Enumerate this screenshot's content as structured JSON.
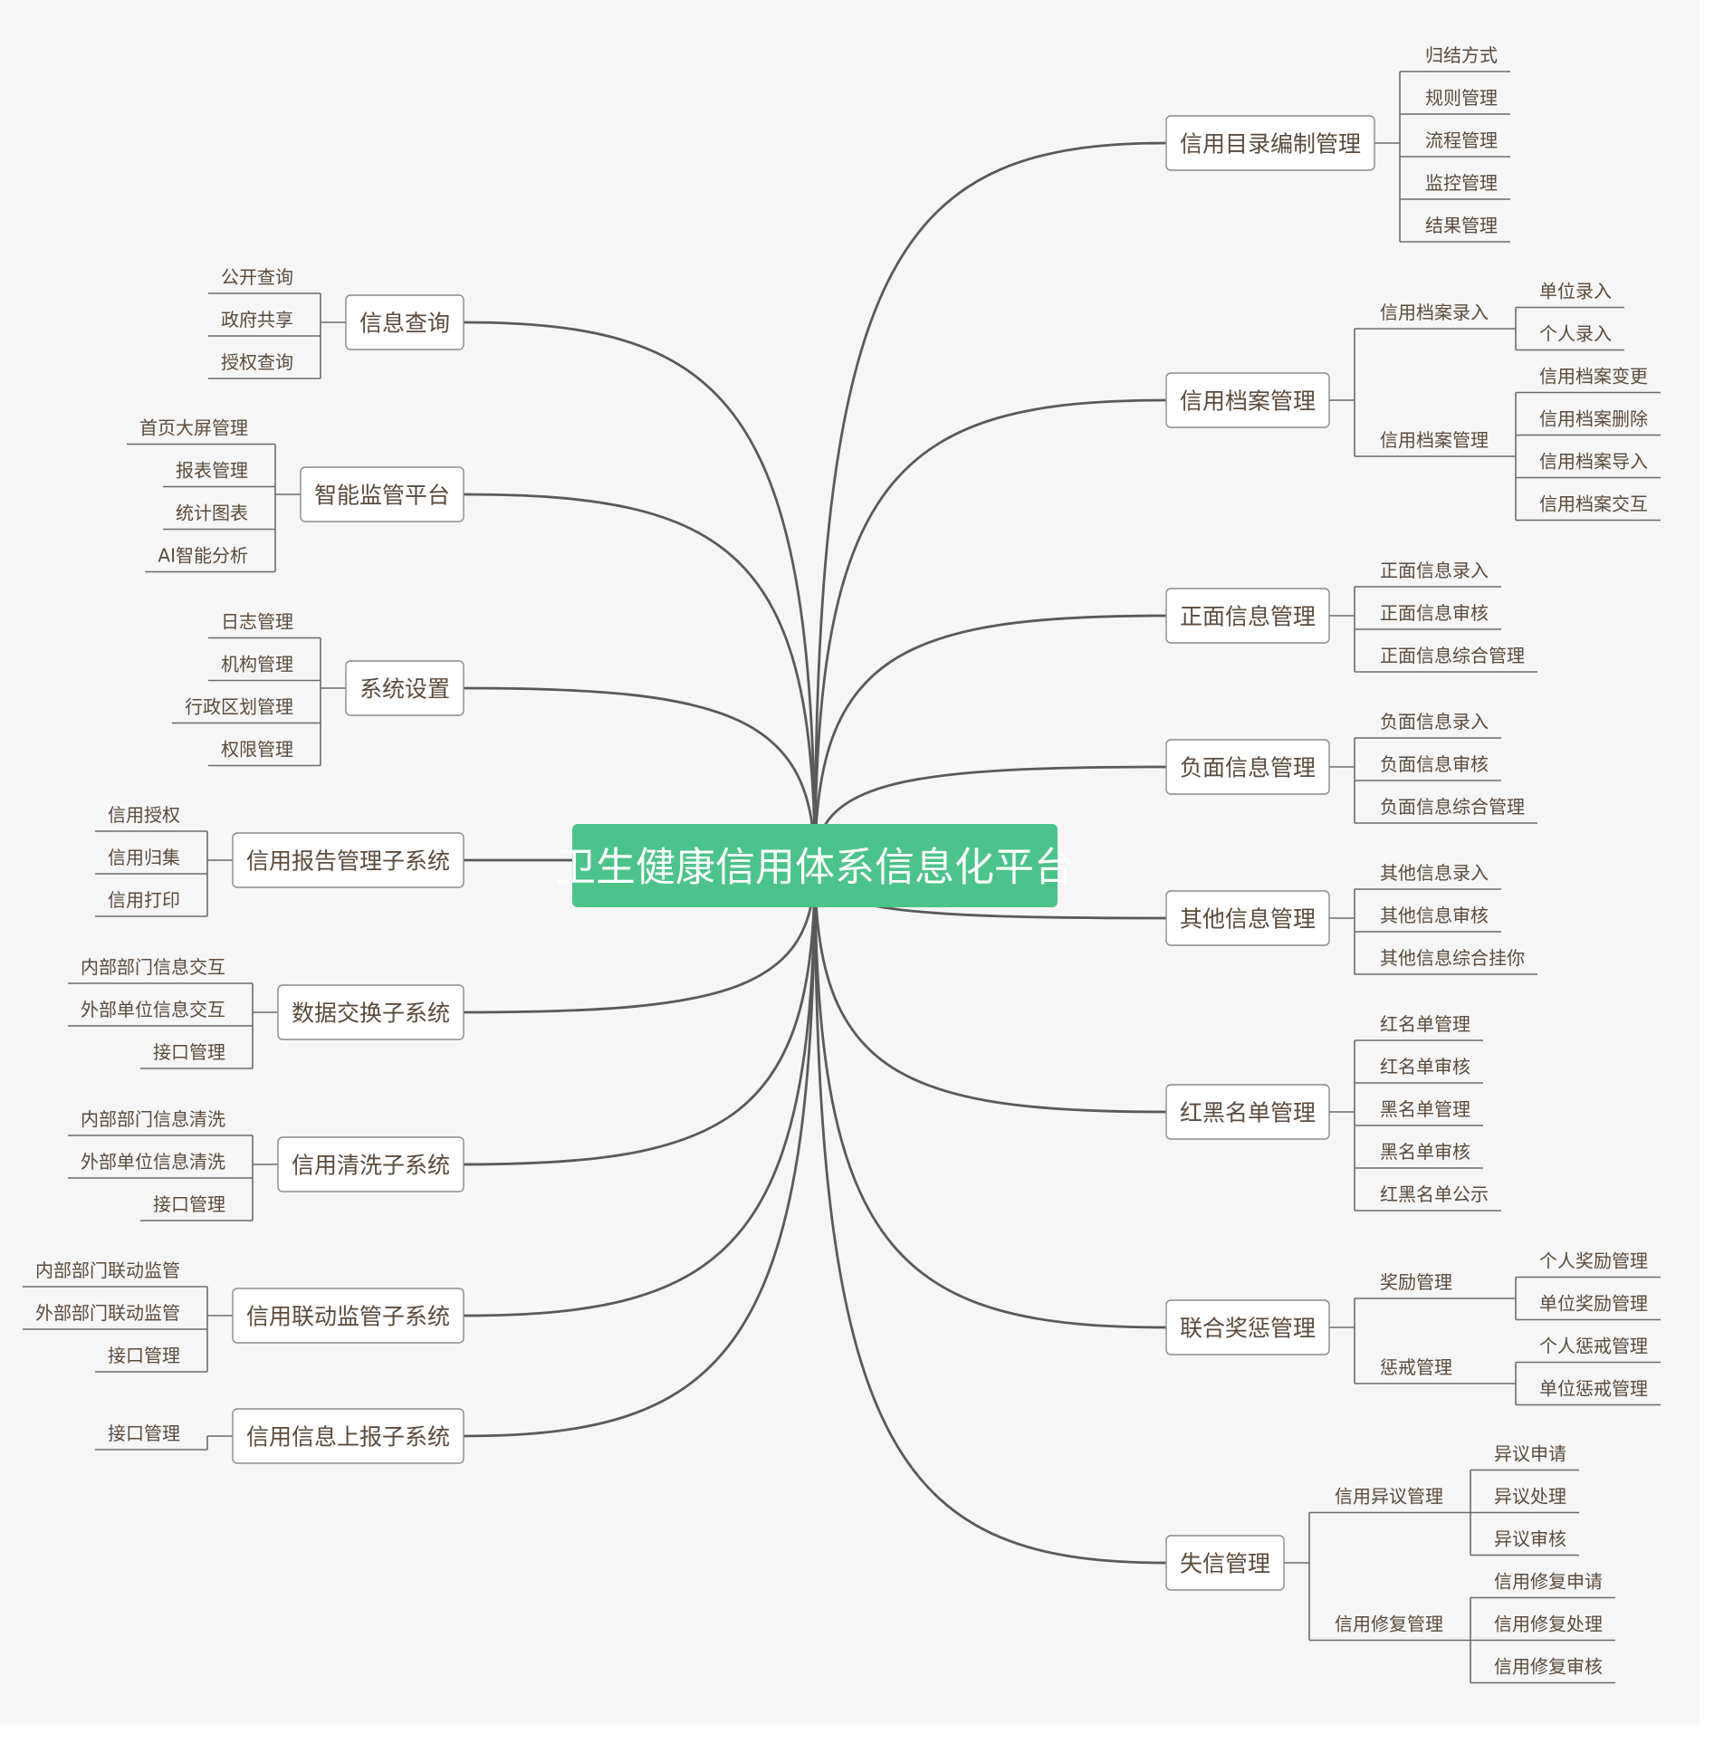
{
  "root": "卫生健康信用体系信息化平台",
  "colors": {
    "background": "#f6f6f6",
    "root_fill": "#4cc38a",
    "root_text": "#ffffff",
    "line": "#5a5a5a",
    "node_border": "#8a8a8a",
    "node_text": "#5b4a3a"
  },
  "left_branches": [
    {
      "label": "信息查询",
      "children": [
        {
          "label": "公开查询"
        },
        {
          "label": "政府共享"
        },
        {
          "label": "授权查询"
        }
      ]
    },
    {
      "label": "智能监管平台",
      "children": [
        {
          "label": "首页大屏管理"
        },
        {
          "label": "报表管理"
        },
        {
          "label": "统计图表"
        },
        {
          "label": "AI智能分析"
        }
      ]
    },
    {
      "label": "系统设置",
      "children": [
        {
          "label": "日志管理"
        },
        {
          "label": "机构管理"
        },
        {
          "label": "行政区划管理"
        },
        {
          "label": "权限管理"
        }
      ]
    },
    {
      "label": "信用报告管理子系统",
      "children": [
        {
          "label": "信用授权"
        },
        {
          "label": "信用归集"
        },
        {
          "label": "信用打印"
        }
      ]
    },
    {
      "label": "数据交换子系统",
      "children": [
        {
          "label": "内部部门信息交互"
        },
        {
          "label": "外部单位信息交互"
        },
        {
          "label": "接口管理"
        }
      ]
    },
    {
      "label": "信用清洗子系统",
      "children": [
        {
          "label": "内部部门信息清洗"
        },
        {
          "label": "外部单位信息清洗"
        },
        {
          "label": "接口管理"
        }
      ]
    },
    {
      "label": "信用联动监管子系统",
      "children": [
        {
          "label": "内部部门联动监管"
        },
        {
          "label": "外部部门联动监管"
        },
        {
          "label": "接口管理"
        }
      ]
    },
    {
      "label": "信用信息上报子系统",
      "children": [
        {
          "label": "接口管理"
        }
      ]
    }
  ],
  "right_branches": [
    {
      "label": "信用目录编制管理",
      "children": [
        {
          "label": "归结方式"
        },
        {
          "label": "规则管理"
        },
        {
          "label": "流程管理"
        },
        {
          "label": "监控管理"
        },
        {
          "label": "结果管理"
        }
      ]
    },
    {
      "label": "信用档案管理",
      "children": [
        {
          "label": "信用档案录入",
          "children": [
            {
              "label": "单位录入"
            },
            {
              "label": "个人录入"
            }
          ]
        },
        {
          "label": "信用档案管理",
          "children": [
            {
              "label": "信用档案变更"
            },
            {
              "label": "信用档案删除"
            },
            {
              "label": "信用档案导入"
            },
            {
              "label": "信用档案交互"
            }
          ]
        }
      ]
    },
    {
      "label": "正面信息管理",
      "children": [
        {
          "label": "正面信息录入"
        },
        {
          "label": "正面信息审核"
        },
        {
          "label": "正面信息综合管理"
        }
      ]
    },
    {
      "label": "负面信息管理",
      "children": [
        {
          "label": "负面信息录入"
        },
        {
          "label": "负面信息审核"
        },
        {
          "label": "负面信息综合管理"
        }
      ]
    },
    {
      "label": "其他信息管理",
      "children": [
        {
          "label": "其他信息录入"
        },
        {
          "label": "其他信息审核"
        },
        {
          "label": "其他信息综合挂你"
        }
      ]
    },
    {
      "label": "红黑名单管理",
      "children": [
        {
          "label": "红名单管理"
        },
        {
          "label": "红名单审核"
        },
        {
          "label": "黑名单管理"
        },
        {
          "label": "黑名单审核"
        },
        {
          "label": "红黑名单公示"
        }
      ]
    },
    {
      "label": "联合奖惩管理",
      "children": [
        {
          "label": "奖励管理",
          "children": [
            {
              "label": "个人奖励管理"
            },
            {
              "label": "单位奖励管理"
            }
          ]
        },
        {
          "label": "惩戒管理",
          "children": [
            {
              "label": "个人惩戒管理"
            },
            {
              "label": "单位惩戒管理"
            }
          ]
        }
      ]
    },
    {
      "label": "失信管理",
      "children": [
        {
          "label": "信用异议管理",
          "children": [
            {
              "label": "异议申请"
            },
            {
              "label": "异议处理"
            },
            {
              "label": "异议审核"
            }
          ]
        },
        {
          "label": "信用修复管理",
          "children": [
            {
              "label": "信用修复申请"
            },
            {
              "label": "信用修复处理"
            },
            {
              "label": "信用修复审核"
            }
          ]
        }
      ]
    }
  ]
}
